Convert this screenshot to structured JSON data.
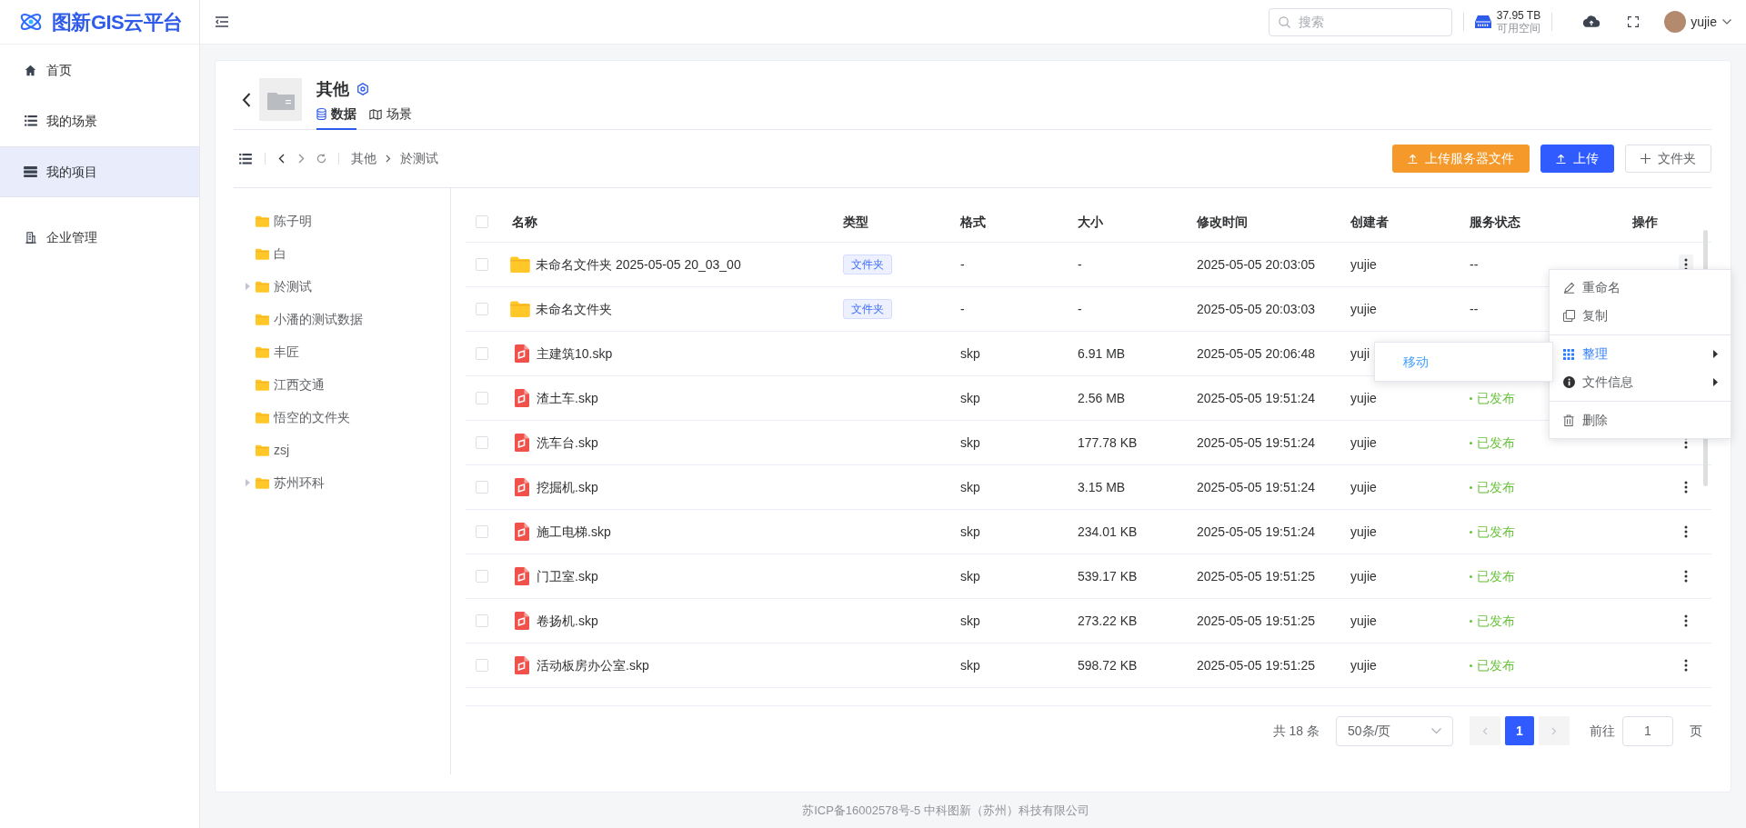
{
  "logo": {
    "text": "图新GIS云平台"
  },
  "sidebar": {
    "items": [
      {
        "label": "首页",
        "selected": false
      },
      {
        "label": "我的场景",
        "selected": false
      },
      {
        "label": "我的项目",
        "selected": true
      },
      {
        "label": "企业管理",
        "selected": false
      }
    ]
  },
  "top_bar": {
    "search": {
      "placeholder": "搜索"
    },
    "storage": {
      "value": "37.95 TB",
      "label": "可用空间"
    },
    "user": {
      "name": "yujie"
    }
  },
  "project": {
    "title": "其他",
    "tabs": [
      {
        "label": "数据",
        "selected": true
      },
      {
        "label": "场景",
        "selected": false
      }
    ]
  },
  "toolbar": {
    "breadcrumb": [
      "其他",
      "於测试"
    ],
    "buttons": [
      {
        "label": "上传服务器文件",
        "kind": "warning"
      },
      {
        "label": "上传",
        "kind": "primary"
      },
      {
        "label": "文件夹",
        "kind": "plain"
      }
    ]
  },
  "tree": {
    "items": [
      {
        "label": "陈子明",
        "expandable": false
      },
      {
        "label": "白",
        "expandable": false
      },
      {
        "label": "於测试",
        "expandable": true
      },
      {
        "label": "小潘的测试数据",
        "expandable": false
      },
      {
        "label": "丰匠",
        "expandable": false
      },
      {
        "label": "江西交通",
        "expandable": false
      },
      {
        "label": "悟空的文件夹",
        "expandable": false
      },
      {
        "label": "zsj",
        "expandable": false
      },
      {
        "label": "苏州环科",
        "expandable": true
      }
    ]
  },
  "table": {
    "all_checked": false,
    "columns": [
      "名称",
      "类型",
      "格式",
      "大小",
      "修改时间",
      "创建者",
      "服务状态",
      "操作"
    ],
    "rows": [
      {
        "checked": false,
        "kind": "folder",
        "name": "未命名文件夹 2025-05-05 20_03_00",
        "type": "文件夹",
        "format": "-",
        "size": "-",
        "modified": "2025-05-05 20:03:05",
        "creator": "yujie",
        "status": "--",
        "published": false
      },
      {
        "checked": false,
        "kind": "folder",
        "name": "未命名文件夹",
        "type": "文件夹",
        "format": "-",
        "size": "-",
        "modified": "2025-05-05 20:03:03",
        "creator": "yujie",
        "status": "--",
        "published": false
      },
      {
        "checked": false,
        "kind": "file",
        "name": "主建筑10.skp",
        "format": "skp",
        "size": "6.91 MB",
        "modified": "2025-05-05 20:06:48",
        "creator": "yuji"
      },
      {
        "checked": false,
        "kind": "file",
        "name": "渣土车.skp",
        "format": "skp",
        "size": "2.56 MB",
        "modified": "2025-05-05 19:51:24",
        "creator": "yujie",
        "status": "已发布",
        "published": true
      },
      {
        "checked": false,
        "kind": "file",
        "name": "洗车台.skp",
        "format": "skp",
        "size": "177.78 KB",
        "modified": "2025-05-05 19:51:24",
        "creator": "yujie",
        "status": "已发布",
        "published": true
      },
      {
        "checked": false,
        "kind": "file",
        "name": "挖掘机.skp",
        "format": "skp",
        "size": "3.15 MB",
        "modified": "2025-05-05 19:51:24",
        "creator": "yujie",
        "status": "已发布",
        "published": true
      },
      {
        "checked": false,
        "kind": "file",
        "name": "施工电梯.skp",
        "format": "skp",
        "size": "234.01 KB",
        "modified": "2025-05-05 19:51:24",
        "creator": "yujie",
        "status": "已发布",
        "published": true
      },
      {
        "checked": false,
        "kind": "file",
        "name": "门卫室.skp",
        "format": "skp",
        "size": "539.17 KB",
        "modified": "2025-05-05 19:51:25",
        "creator": "yujie",
        "status": "已发布",
        "published": true
      },
      {
        "checked": false,
        "kind": "file",
        "name": "卷扬机.skp",
        "format": "skp",
        "size": "273.22 KB",
        "modified": "2025-05-05 19:51:25",
        "creator": "yujie",
        "status": "已发布",
        "published": true
      },
      {
        "checked": false,
        "kind": "file",
        "name": "活动板房办公室.skp",
        "format": "skp",
        "size": "598.72 KB",
        "modified": "2025-05-05 19:51:25",
        "creator": "yujie",
        "status": "已发布",
        "published": true
      }
    ]
  },
  "pagination": {
    "total": "共 18 条",
    "page_size": "50条/页",
    "pages": [
      {
        "label": "1",
        "selected": true
      }
    ],
    "goto_label": "前往",
    "goto_value": "1",
    "goto_suffix": "页"
  },
  "context_menu": {
    "groups": [
      [
        {
          "label": "重命名",
          "selected": false,
          "submenu": false
        },
        {
          "label": "复制",
          "selected": false,
          "submenu": false
        }
      ],
      [
        {
          "label": "整理",
          "selected": true,
          "submenu": true
        },
        {
          "label": "文件信息",
          "selected": false,
          "submenu": true
        }
      ],
      [
        {
          "label": "删除",
          "selected": false,
          "submenu": false
        }
      ]
    ]
  },
  "submenu": {
    "items": [
      {
        "label": "移动",
        "selected": true
      }
    ]
  },
  "footer": {
    "text": "苏ICP备16002578号-5 中科图新（苏州）科技有限公司"
  }
}
